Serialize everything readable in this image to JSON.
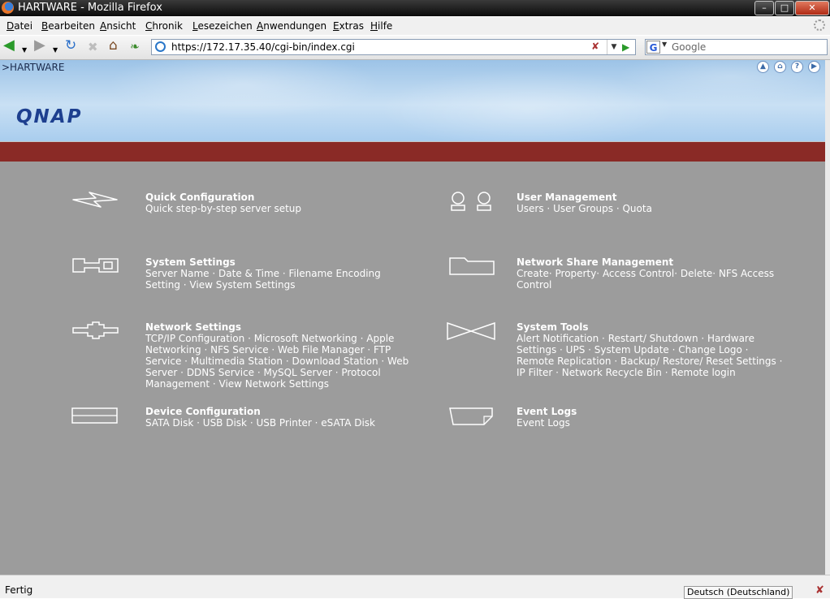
{
  "window": {
    "title": "HARTWARE - Mozilla Firefox"
  },
  "menu": [
    {
      "pre": "",
      "ul": "D",
      "post": "atei"
    },
    {
      "pre": "",
      "ul": "B",
      "post": "earbeiten"
    },
    {
      "pre": "",
      "ul": "A",
      "post": "nsicht"
    },
    {
      "pre": "",
      "ul": "C",
      "post": "hronik"
    },
    {
      "pre": "",
      "ul": "L",
      "post": "esezeichen"
    },
    {
      "pre": "",
      "ul": "A",
      "post": "nwendungen"
    },
    {
      "pre": "",
      "ul": "E",
      "post": "xtras"
    },
    {
      "pre": "",
      "ul": "H",
      "post": "ilfe"
    }
  ],
  "address": {
    "url": "https://172.17.35.40/cgi-bin/index.cgi"
  },
  "search": {
    "placeholder": "Google",
    "engine": "G"
  },
  "header": {
    "breadcrumb": ">HARTWARE",
    "logo": "QNAP"
  },
  "sections": {
    "quick": {
      "title": "Quick Configuration",
      "links": [
        "Quick step-by-step server setup"
      ]
    },
    "system": {
      "title": "System Settings",
      "links": [
        "Server Name",
        "Date & Time",
        "Filename Encoding Setting",
        "View System Settings"
      ]
    },
    "network": {
      "title": "Network Settings",
      "links": [
        "TCP/IP Configuration",
        "Microsoft Networking",
        "Apple Networking",
        "NFS Service",
        "Web File Manager",
        "FTP Service",
        "Multimedia Station",
        "Download Station",
        "Web Server",
        "DDNS Service",
        "MySQL Server",
        "Protocol Management",
        "View Network Settings"
      ]
    },
    "device": {
      "title": "Device Configuration",
      "links": [
        "SATA Disk",
        "USB Disk",
        "USB Printer",
        "eSATA Disk"
      ]
    },
    "user": {
      "title": "User Management",
      "links": [
        "Users",
        "User Groups",
        "Quota"
      ]
    },
    "share": {
      "title": "Network Share Management",
      "links": [
        "Create",
        "Property",
        "Access Control",
        "Delete",
        "NFS Access Control"
      ]
    },
    "tools": {
      "title": "System Tools",
      "links": [
        "Alert Notification",
        "Restart/ Shutdown",
        "Hardware Settings",
        "UPS",
        "System Update",
        "Change Logo",
        "Remote Replication",
        "Backup/ Restore/ Reset Settings",
        "IP Filter",
        "Network Recycle Bin",
        "Remote login"
      ]
    },
    "events": {
      "title": "Event Logs",
      "links": [
        "Event Logs"
      ]
    }
  },
  "status": {
    "text": "Fertig",
    "language": "Deutsch (Deutschland)"
  }
}
